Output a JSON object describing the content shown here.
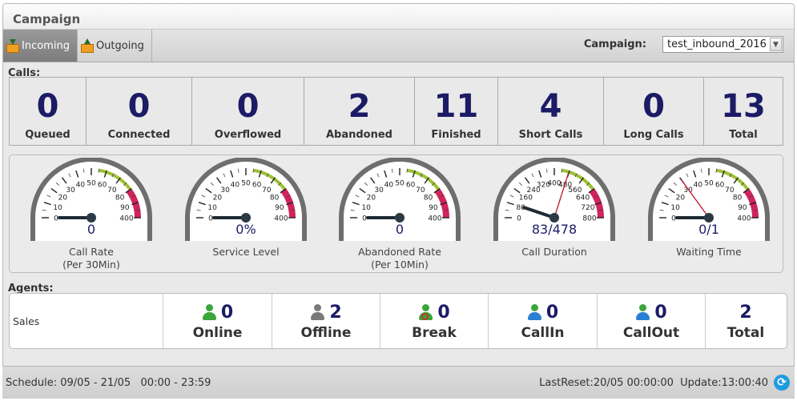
{
  "title": "Campaign",
  "tabs": [
    {
      "label": "Incoming",
      "icon": "inbox-download-icon",
      "active": true
    },
    {
      "label": "Outgoing",
      "icon": "inbox-upload-icon",
      "active": false
    }
  ],
  "campaign": {
    "label": "Campaign:",
    "selected": "test_inbound_2016"
  },
  "calls": {
    "label": "Calls:",
    "cells": [
      {
        "value": "0",
        "label": "Queued",
        "color": "#9fcdd1"
      },
      {
        "value": "0",
        "label": "Connected",
        "color": "#fdc7c7"
      },
      {
        "value": "0",
        "label": "Overflowed",
        "color": "#fdcc9a"
      },
      {
        "value": "2",
        "label": "Abandoned",
        "color": "#9fcdd1"
      },
      {
        "value": "11",
        "label": "Finished",
        "color": "#fdc7c7"
      },
      {
        "value": "4",
        "label": "Short Calls",
        "color": "#fdcc9a"
      },
      {
        "value": "0",
        "label": "Long Calls",
        "color": "#9fcdd1"
      },
      {
        "value": "13",
        "label": "Total",
        "color": "#fdc7c7"
      }
    ]
  },
  "gauges": [
    {
      "caption1": "Call Rate",
      "caption2": "(Per 30Min)",
      "value": "0",
      "ticks": [
        "0",
        "10",
        "20",
        "30",
        "40",
        "50",
        "60",
        "70",
        "80",
        "90",
        "400"
      ],
      "needle": 0
    },
    {
      "caption1": "Service Level",
      "caption2": "",
      "value": "0%",
      "ticks": [
        "0",
        "10",
        "20",
        "30",
        "40",
        "50",
        "60",
        "70",
        "80",
        "90",
        "400"
      ],
      "needle": 0
    },
    {
      "caption1": "Abandoned Rate",
      "caption2": "(Per 10Min)",
      "value": "0",
      "ticks": [
        "0",
        "10",
        "20",
        "30",
        "40",
        "50",
        "60",
        "70",
        "80",
        "90",
        "400"
      ],
      "needle": 0
    },
    {
      "caption1": "Call Duration",
      "caption2": "",
      "value": "83/478",
      "ticks": [
        "0",
        "80",
        "160",
        "240",
        "320",
        "400",
        "480",
        "560",
        "640",
        "720",
        "800"
      ],
      "needle": 83,
      "needle2": 478,
      "max": 800
    },
    {
      "caption1": "Waiting Time",
      "caption2": "",
      "value": "0/1",
      "ticks": [
        "0",
        "10",
        "20",
        "30",
        "40",
        "50",
        "60",
        "70",
        "80",
        "90",
        "400"
      ],
      "needle": 0,
      "needle2": 0.3
    }
  ],
  "agents": {
    "label": "Agents:",
    "group": "Sales",
    "cells": [
      {
        "value": "0",
        "label": "Online",
        "icon": "agent-online-icon",
        "color": "#3aa53a"
      },
      {
        "value": "2",
        "label": "Offline",
        "icon": "agent-offline-icon",
        "color": "#7a7a7a"
      },
      {
        "value": "0",
        "label": "Break",
        "icon": "agent-break-icon",
        "color": "#3aa53a"
      },
      {
        "value": "0",
        "label": "CallIn",
        "icon": "agent-callin-icon",
        "color": "#2a7fd4"
      },
      {
        "value": "0",
        "label": "CallOut",
        "icon": "agent-callout-icon",
        "color": "#2a7fd4"
      },
      {
        "value": "2",
        "label": "Total",
        "icon": "",
        "color": ""
      }
    ]
  },
  "status": {
    "schedule": "Schedule: 09/05 - 21/05   00:00 - 23:59",
    "reset": "LastReset:20/05 00:00:00  Update:13:00:40"
  }
}
